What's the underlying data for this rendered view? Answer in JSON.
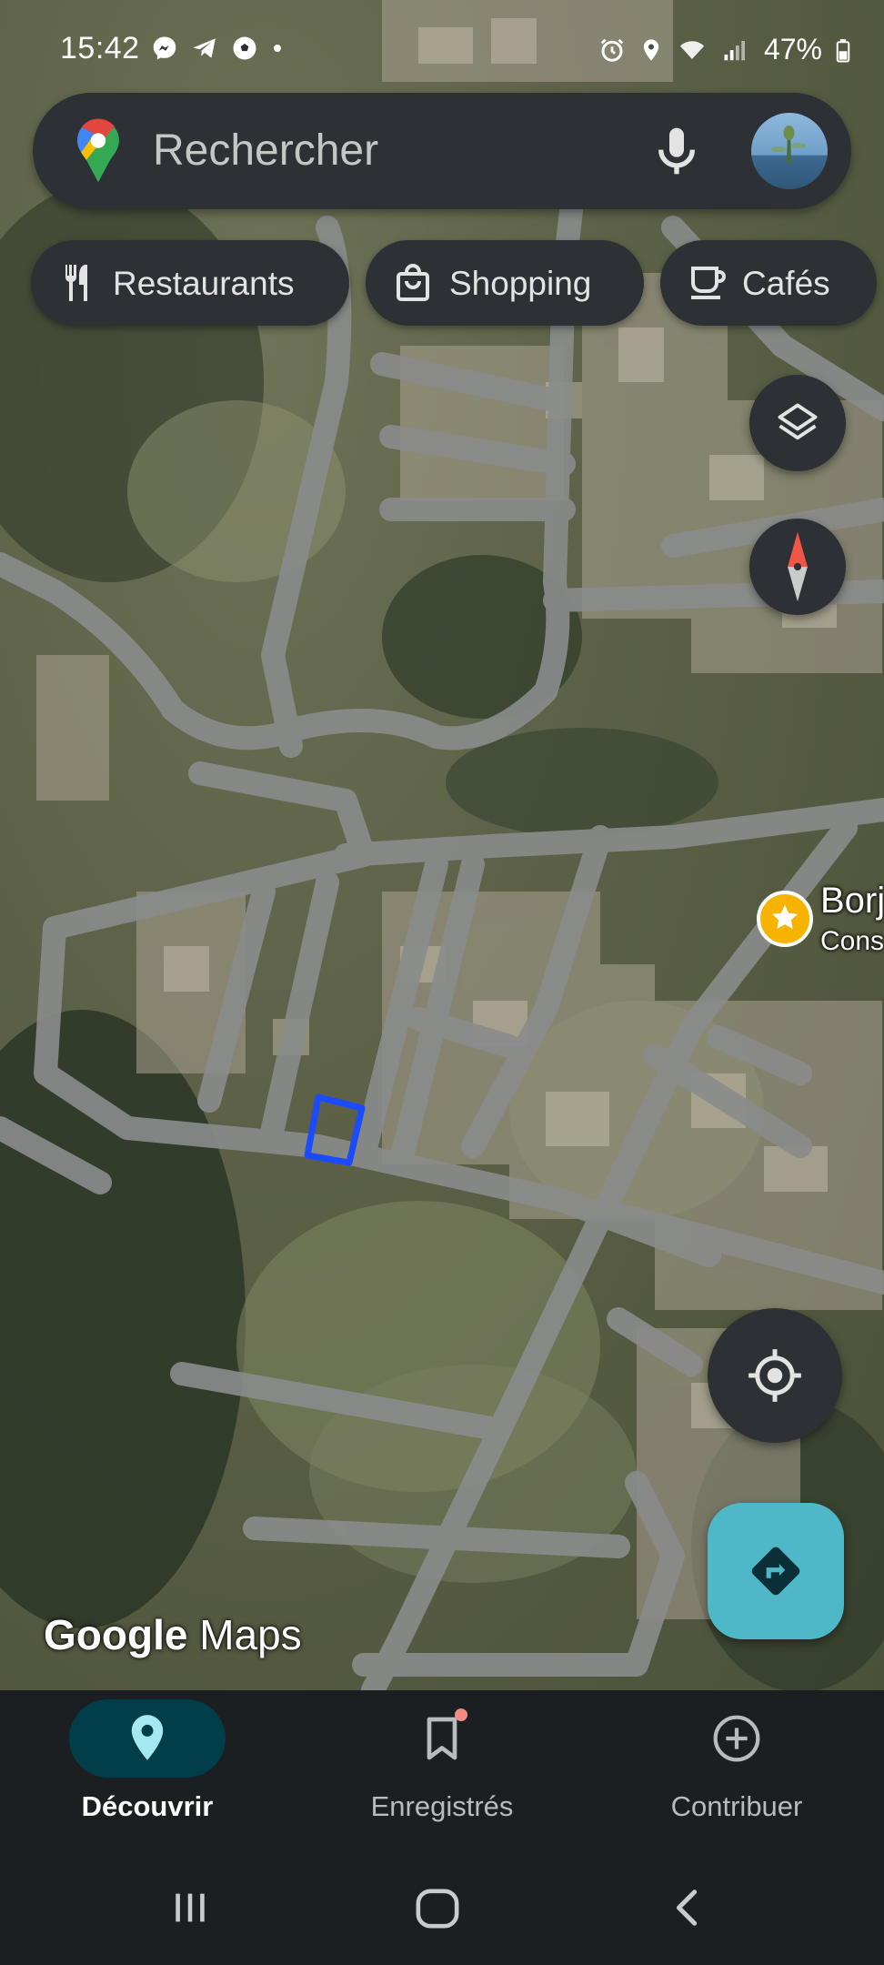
{
  "status_bar": {
    "time": "15:42",
    "battery": "47%",
    "left_icons": [
      "messenger-icon",
      "telegram-icon",
      "soccer-ball-icon",
      "dot-icon"
    ],
    "right_icons": [
      "alarm-icon",
      "location-icon",
      "wifi-icon",
      "signal-icon",
      "battery-icon"
    ]
  },
  "search": {
    "placeholder": "Rechercher",
    "logo_icon": "google-maps-pin-icon",
    "mic_icon": "microphone-icon",
    "avatar_icon": "profile-avatar"
  },
  "chips": [
    {
      "label": "Restaurants",
      "icon": "fork-knife-icon"
    },
    {
      "label": "Shopping",
      "icon": "shopping-bag-icon"
    },
    {
      "label": "Cafés",
      "icon": "coffee-cup-icon"
    }
  ],
  "map": {
    "place": {
      "name": "Borj",
      "subtitle": "Cons",
      "icon": "star-icon"
    },
    "watermark": {
      "brand": "Google",
      "product": "Maps"
    },
    "buttons": {
      "layers_icon": "layers-icon",
      "compass_icon": "compass-icon",
      "locate_icon": "my-location-icon",
      "directions_icon": "directions-icon"
    },
    "colors": {
      "satellite": "#5c6147",
      "road": "#8a8c8c",
      "highlight": "#1a4bff",
      "star": "#f6b400",
      "directions": "#4fb8c8"
    }
  },
  "bottom_nav": {
    "items": [
      {
        "label": "Découvrir",
        "icon": "explore-pin-icon",
        "active": true
      },
      {
        "label": "Enregistrés",
        "icon": "bookmark-icon",
        "active": false
      },
      {
        "label": "Contribuer",
        "icon": "add-circle-icon",
        "active": false
      }
    ],
    "active_color": "#003f4a"
  },
  "system_nav": {
    "icons": [
      "recent-apps-icon",
      "home-icon",
      "back-icon"
    ]
  }
}
